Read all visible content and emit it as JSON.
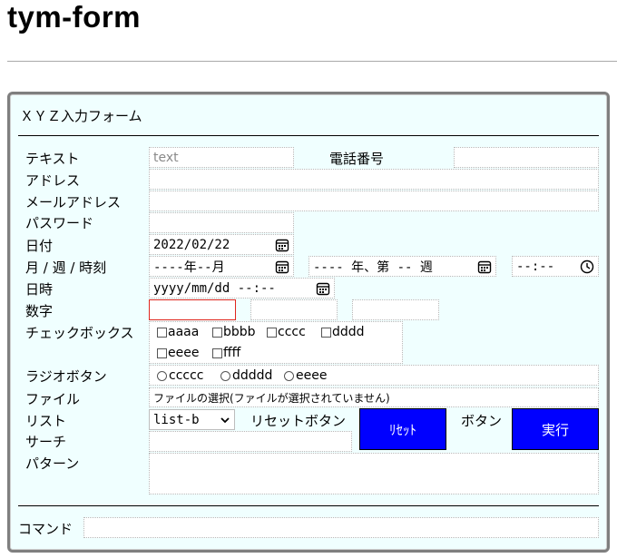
{
  "page": {
    "title": "tym-form"
  },
  "form": {
    "legend": "ＸＹＺ入力フォーム",
    "labels": {
      "text": "テキスト",
      "phone": "電話番号",
      "address": "アドレス",
      "email": "メールアドレス",
      "password": "パスワード",
      "date": "日付",
      "month_week_time": "月 / 週 / 時刻",
      "datetime": "日時",
      "number": "数字",
      "checkbox": "チェックボックス",
      "radio": "ラジオボタン",
      "file": "ファイル",
      "list": "リスト",
      "reset_label": "リセットボタン",
      "button_label": "ボタン",
      "search": "サーチ",
      "pattern": "パターン",
      "command": "コマンド"
    },
    "text_placeholder": "text",
    "date_value": "2022/02/22",
    "month_value": "----年--月",
    "week_value": "---- 年、第 -- 週",
    "time_value": "--:--",
    "datetime_value": "yyyy/mm/dd --:--",
    "checkboxes": [
      "aaaa",
      "bbbb",
      "cccc",
      "dddd",
      "eeee",
      "ffff"
    ],
    "radios": [
      "ccccc",
      "ddddd",
      "eeee"
    ],
    "file_text": "ファイルの選択(ファイルが選択されていません)",
    "list_selected": "list-b",
    "reset_button": "ﾘｾｯﾄ",
    "submit_button": "実行",
    "colors": {
      "button_bg": "#0000ff",
      "form_bg": "#f0ffff",
      "invalid_border": "#e0271f"
    }
  }
}
